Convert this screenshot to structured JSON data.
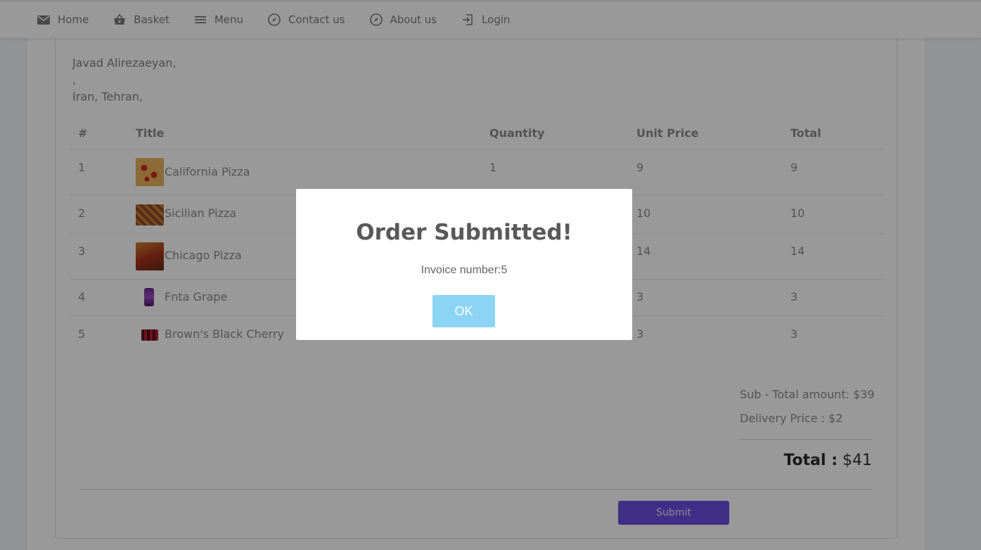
{
  "nav": {
    "items": [
      {
        "label": "Home",
        "icon": "mail-icon"
      },
      {
        "label": "Basket",
        "icon": "basket-icon"
      },
      {
        "label": "Menu",
        "icon": "menu-icon"
      },
      {
        "label": "Contact us",
        "icon": "compass-icon"
      },
      {
        "label": "About us",
        "icon": "compass-icon"
      },
      {
        "label": "Login",
        "icon": "login-icon"
      }
    ]
  },
  "address": {
    "line1": "Javad Alirezaeyan,",
    "line2": ",",
    "line3": "Iran, Tehran,"
  },
  "table": {
    "headers": [
      "#",
      "Title",
      "Quantity",
      "Unit Price",
      "Total"
    ],
    "rows": [
      {
        "num": "1",
        "title": "California Pizza",
        "qty": "1",
        "unit": "9",
        "total": "9"
      },
      {
        "num": "2",
        "title": "Sicilian Pizza",
        "qty": "",
        "unit": "10",
        "total": "10"
      },
      {
        "num": "3",
        "title": "Chicago Pizza",
        "qty": "",
        "unit": "14",
        "total": "14"
      },
      {
        "num": "4",
        "title": "Fnta Grape",
        "qty": "",
        "unit": "3",
        "total": "3"
      },
      {
        "num": "5",
        "title": "Brown's Black Cherry",
        "qty": "",
        "unit": "3",
        "total": "3"
      }
    ]
  },
  "summary": {
    "subtotal": "Sub - Total amount: $39",
    "delivery": "Delivery Price : $2",
    "total_label": "Total :",
    "total_value": "$41"
  },
  "submit_label": "Submit",
  "modal": {
    "title": "Order Submitted!",
    "text": "Invoice number:5",
    "ok_label": "OK"
  },
  "colors": {
    "submit": "#6a4fe0",
    "ok": "#8cd4f5"
  }
}
